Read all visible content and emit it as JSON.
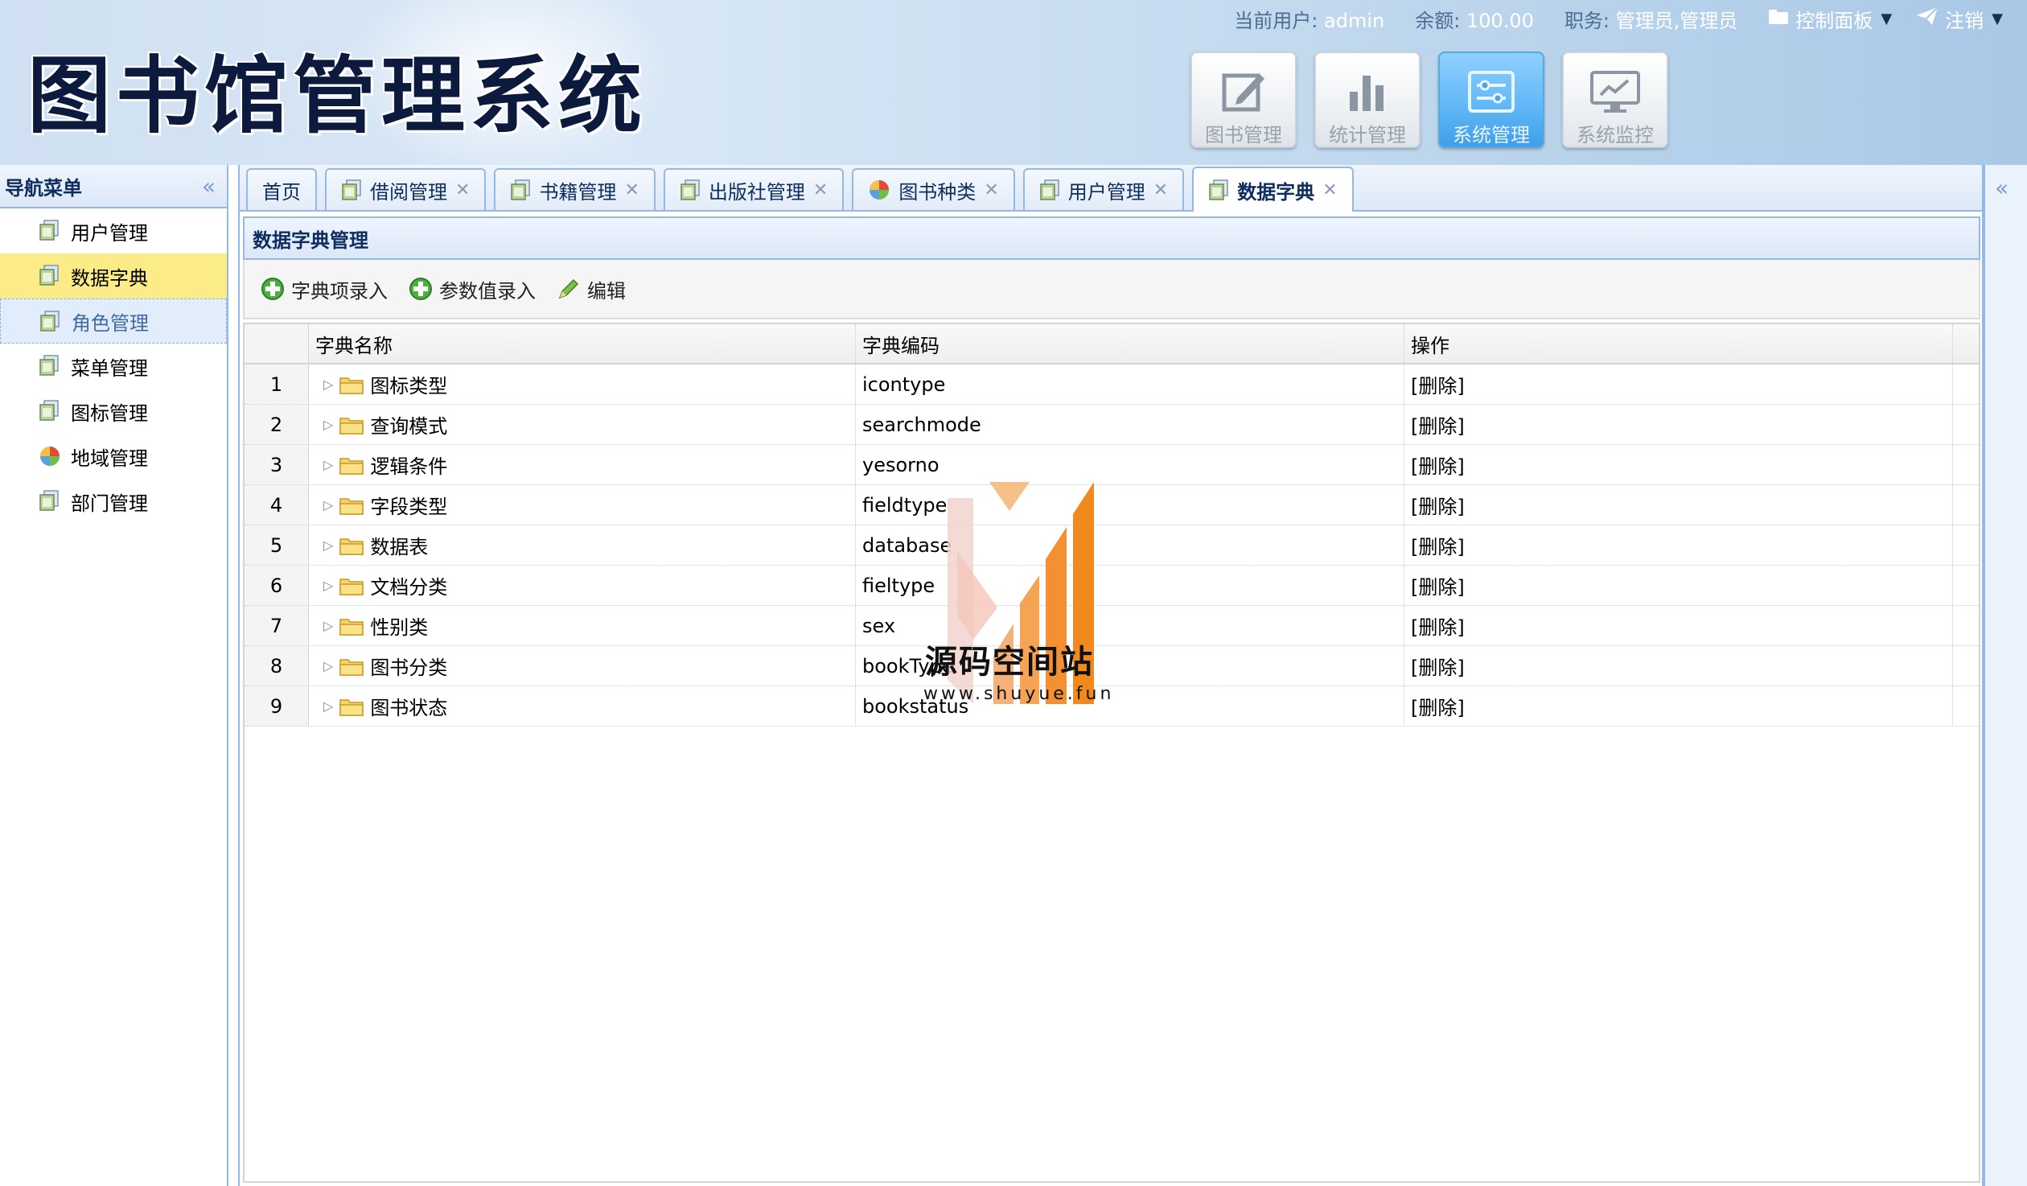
{
  "header": {
    "logo_text": "图书馆管理系统",
    "current_user_label": "当前用户:",
    "current_user": "admin",
    "balance_label": "余额:",
    "balance": "100.00",
    "role_label": "职务:",
    "role": "管理员,管理员",
    "control_panel": "控制面板",
    "logout": "注销",
    "modules": [
      {
        "label": "图书管理",
        "icon": "edit-icon",
        "active": false
      },
      {
        "label": "统计管理",
        "icon": "bar-chart-icon",
        "active": false
      },
      {
        "label": "系统管理",
        "icon": "settings-sliders-icon",
        "active": true
      },
      {
        "label": "系统监控",
        "icon": "monitor-icon",
        "active": false
      }
    ]
  },
  "sidebar": {
    "title": "导航菜单",
    "items": [
      {
        "label": "用户管理",
        "icon": "page-icon"
      },
      {
        "label": "数据字典",
        "icon": "page-icon",
        "state": "selected"
      },
      {
        "label": "角色管理",
        "icon": "page-icon",
        "state": "hover"
      },
      {
        "label": "菜单管理",
        "icon": "page-icon"
      },
      {
        "label": "图标管理",
        "icon": "page-icon"
      },
      {
        "label": "地域管理",
        "icon": "globe-icon"
      },
      {
        "label": "部门管理",
        "icon": "page-icon"
      }
    ]
  },
  "tabs": [
    {
      "label": "首页",
      "closable": false,
      "icon": null
    },
    {
      "label": "借阅管理",
      "closable": true,
      "icon": "page-icon"
    },
    {
      "label": "书籍管理",
      "closable": true,
      "icon": "page-icon"
    },
    {
      "label": "出版社管理",
      "closable": true,
      "icon": "page-icon"
    },
    {
      "label": "图书种类",
      "closable": true,
      "icon": "globe-icon"
    },
    {
      "label": "用户管理",
      "closable": true,
      "icon": "page-icon"
    },
    {
      "label": "数据字典",
      "closable": true,
      "icon": "page-icon",
      "active": true
    }
  ],
  "panel": {
    "title": "数据字典管理",
    "toolbar": [
      {
        "label": "字典项录入",
        "icon": "add-icon"
      },
      {
        "label": "参数值录入",
        "icon": "add-icon"
      },
      {
        "label": "编辑",
        "icon": "pencil-icon"
      }
    ]
  },
  "table": {
    "columns": [
      "字典名称",
      "字典编码",
      "操作"
    ],
    "rows": [
      {
        "num": "1",
        "name": "图标类型",
        "code": "icontype",
        "op": "[删除]"
      },
      {
        "num": "2",
        "name": "查询模式",
        "code": "searchmode",
        "op": "[删除]"
      },
      {
        "num": "3",
        "name": "逻辑条件",
        "code": "yesorno",
        "op": "[删除]"
      },
      {
        "num": "4",
        "name": "字段类型",
        "code": "fieldtype",
        "op": "[删除]"
      },
      {
        "num": "5",
        "name": "数据表",
        "code": "database",
        "op": "[删除]"
      },
      {
        "num": "6",
        "name": "文档分类",
        "code": "fieltype",
        "op": "[删除]"
      },
      {
        "num": "7",
        "name": "性别类",
        "code": "sex",
        "op": "[删除]"
      },
      {
        "num": "8",
        "name": "图书分类",
        "code": "bookType",
        "op": "[删除]"
      },
      {
        "num": "9",
        "name": "图书状态",
        "code": "bookstatus",
        "op": "[删除]"
      }
    ]
  },
  "watermark": {
    "text": "源码空间站",
    "url": "www.shuyue.fun"
  },
  "colors": {
    "border": "#95b8e7",
    "selected": "#fbec88",
    "active_module": "#5fb6f6"
  }
}
